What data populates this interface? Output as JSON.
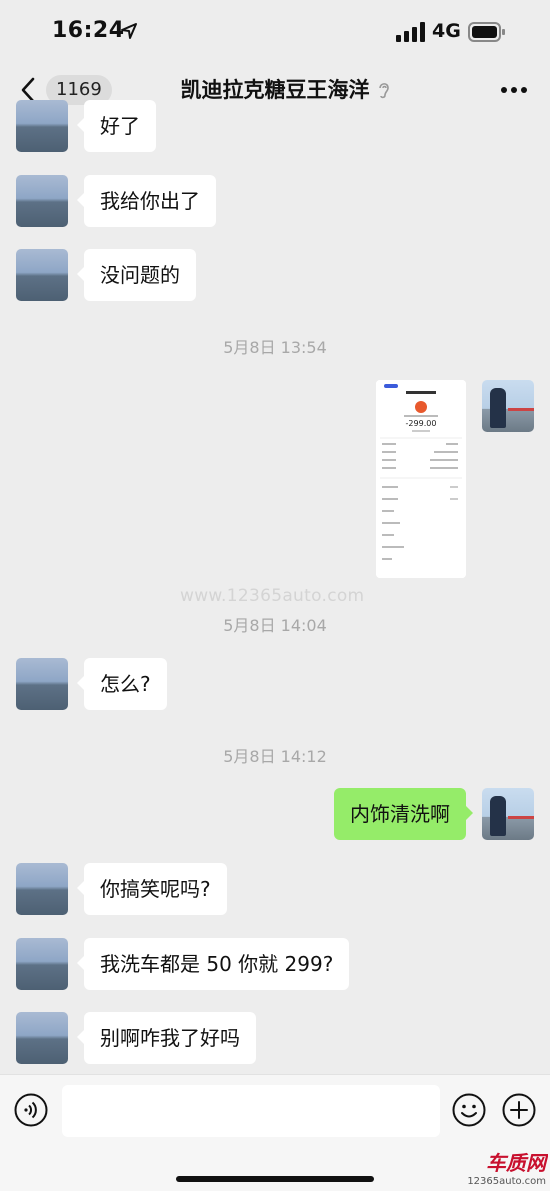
{
  "status": {
    "time": "16:24",
    "network": "4G"
  },
  "nav": {
    "back_count": "1169",
    "title": "凯迪拉克糖豆王海洋"
  },
  "messages": [
    {
      "text": "好了"
    },
    {
      "text": "我给你出了"
    },
    {
      "text": "没问题的"
    },
    {
      "text": "怎么?"
    },
    {
      "text": "内饰清洗啊"
    },
    {
      "text": "你搞笑呢吗?"
    },
    {
      "text": "我洗车都是 50 你就 299?"
    },
    {
      "text": "别啊咋我了好吗"
    }
  ],
  "timestamps": [
    "5月8日 13:54",
    "5月8日 14:04",
    "5月8日 14:12"
  ],
  "image_message": {
    "price": "-299.00"
  },
  "watermark": "www.12365auto.com",
  "input": {
    "placeholder": "",
    "value": ""
  },
  "logo": {
    "brand": "车质网",
    "url": "12365auto.com"
  },
  "colors": {
    "my_bubble": "#95ec69",
    "their_bubble": "#ffffff",
    "background": "#ededed"
  }
}
